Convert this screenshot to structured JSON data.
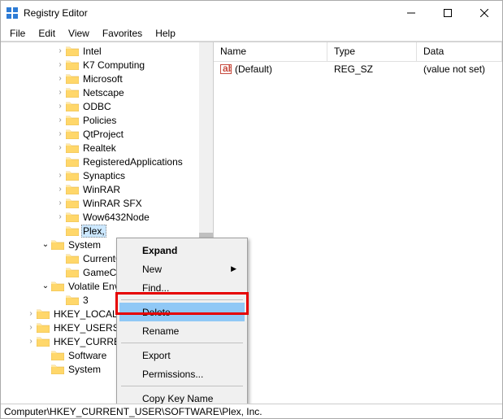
{
  "title": "Registry Editor",
  "menu": [
    "File",
    "Edit",
    "View",
    "Favorites",
    "Help"
  ],
  "tree": {
    "items": [
      {
        "chev": ">",
        "label": "Intel",
        "lvl": 2
      },
      {
        "chev": ">",
        "label": "K7 Computing",
        "lvl": 2
      },
      {
        "chev": ">",
        "label": "Microsoft",
        "lvl": 2
      },
      {
        "chev": ">",
        "label": "Netscape",
        "lvl": 2
      },
      {
        "chev": ">",
        "label": "ODBC",
        "lvl": 2
      },
      {
        "chev": ">",
        "label": "Policies",
        "lvl": 2
      },
      {
        "chev": ">",
        "label": "QtProject",
        "lvl": 2
      },
      {
        "chev": ">",
        "label": "Realtek",
        "lvl": 2
      },
      {
        "chev": "",
        "label": "RegisteredApplications",
        "lvl": 2
      },
      {
        "chev": ">",
        "label": "Synaptics",
        "lvl": 2
      },
      {
        "chev": ">",
        "label": "WinRAR",
        "lvl": 2
      },
      {
        "chev": ">",
        "label": "WinRAR SFX",
        "lvl": 2
      },
      {
        "chev": ">",
        "label": "Wow6432Node",
        "lvl": 2
      },
      {
        "chev": "",
        "label": "Plex, Inc.",
        "lvl": 2,
        "sel": true
      },
      {
        "chev": "v",
        "label": "System",
        "lvl": 1
      },
      {
        "chev": "",
        "label": "CurrentControlSet",
        "lvl": 2,
        "cut": true
      },
      {
        "chev": "",
        "label": "GameConfigStore",
        "lvl": 2,
        "cut": true
      },
      {
        "chev": "v",
        "label": "Volatile Environment",
        "lvl": 1,
        "cut": true
      },
      {
        "chev": "",
        "label": "3",
        "lvl": 2
      },
      {
        "chev": ">",
        "label": "HKEY_LOCAL_MACHINE",
        "lvl": 0,
        "cut": true
      },
      {
        "chev": ">",
        "label": "HKEY_USERS",
        "lvl": 0,
        "cut": true
      },
      {
        "chev": ">",
        "label": "HKEY_CURRENT_CONFIG",
        "lvl": 0,
        "cut": true
      },
      {
        "chev": "",
        "label": "Software",
        "lvl": 1
      },
      {
        "chev": "",
        "label": "System",
        "lvl": 1
      }
    ]
  },
  "list": {
    "cols": [
      "Name",
      "Type",
      "Data"
    ],
    "rows": [
      {
        "name": "(Default)",
        "type": "REG_SZ",
        "data": "(value not set)"
      }
    ]
  },
  "context": {
    "items": [
      {
        "label": "Expand",
        "bold": true
      },
      {
        "label": "New",
        "sub": true
      },
      {
        "label": "Find...",
        "sep": true
      },
      {
        "label": "Delete",
        "hl": true
      },
      {
        "label": "Rename",
        "sep": true
      },
      {
        "label": "Export"
      },
      {
        "label": "Permissions...",
        "sep": true
      },
      {
        "label": "Copy Key Name"
      }
    ]
  },
  "status": "Computer\\HKEY_CURRENT_USER\\SOFTWARE\\Plex, Inc."
}
